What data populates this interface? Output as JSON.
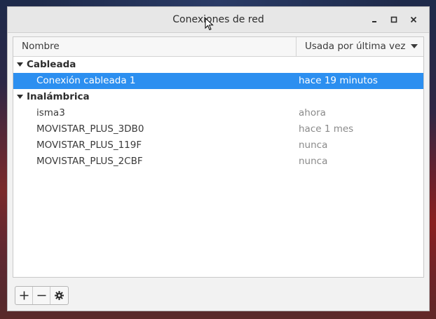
{
  "window": {
    "title": "Conexiones de red",
    "controls": [
      "minimize-icon",
      "maximize-icon",
      "close-icon"
    ]
  },
  "table": {
    "columns": {
      "name": "Nombre",
      "last_used": "Usada por última vez"
    },
    "groups": [
      {
        "label": "Cableada",
        "connections": [
          {
            "name": "Conexión cableada 1",
            "last_used": "hace 19 minutos",
            "selected": true
          }
        ]
      },
      {
        "label": "Inalámbrica",
        "connections": [
          {
            "name": "isma3",
            "last_used": "ahora"
          },
          {
            "name": "MOVISTAR_PLUS_3DB0",
            "last_used": "hace 1 mes"
          },
          {
            "name": "MOVISTAR_PLUS_119F",
            "last_used": "nunca"
          },
          {
            "name": "MOVISTAR_PLUS_2CBF",
            "last_used": "nunca"
          }
        ]
      }
    ]
  },
  "toolbar": {
    "buttons": [
      "add-icon",
      "remove-icon",
      "gear-icon"
    ]
  },
  "colors": {
    "selection": "#2c8ff0",
    "muted_text": "#8a8a8a"
  }
}
